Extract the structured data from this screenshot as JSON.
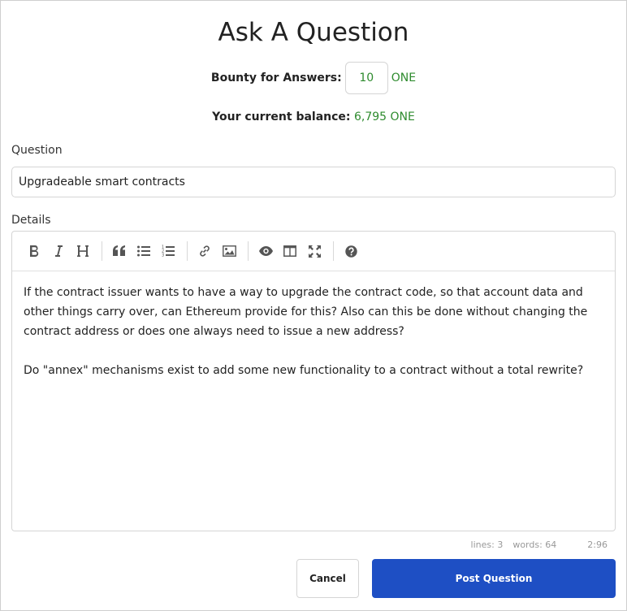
{
  "page": {
    "title": "Ask A Question"
  },
  "bounty": {
    "label": "Bounty for Answers:",
    "value": "10",
    "unit": "ONE"
  },
  "balance": {
    "label": "Your current balance:",
    "value": "6,795 ONE"
  },
  "question": {
    "label": "Question",
    "value": "Upgradeable smart contracts"
  },
  "details": {
    "label": "Details",
    "toolbar": [
      "bold-icon",
      "italic-icon",
      "heading-icon",
      "quote-icon",
      "unordered-list-icon",
      "ordered-list-icon",
      "link-icon",
      "image-icon",
      "preview-icon",
      "side-by-side-icon",
      "fullscreen-icon",
      "help-icon"
    ],
    "paragraphs": [
      "If the contract issuer wants to have a way to upgrade the contract code, so that account data and other things carry over, can Ethereum provide for this? Also can this be done without changing the contract address or does one always need to issue a new address?",
      "Do \"annex\" mechanisms exist to add some new functionality to a contract without a total rewrite?"
    ],
    "status": {
      "lines": "lines: 3",
      "words": "words: 64",
      "cursor": "2:96"
    }
  },
  "actions": {
    "cancel": "Cancel",
    "post": "Post Question"
  },
  "colors": {
    "accent": "#1e4fc4",
    "green": "#2e8b2e"
  }
}
